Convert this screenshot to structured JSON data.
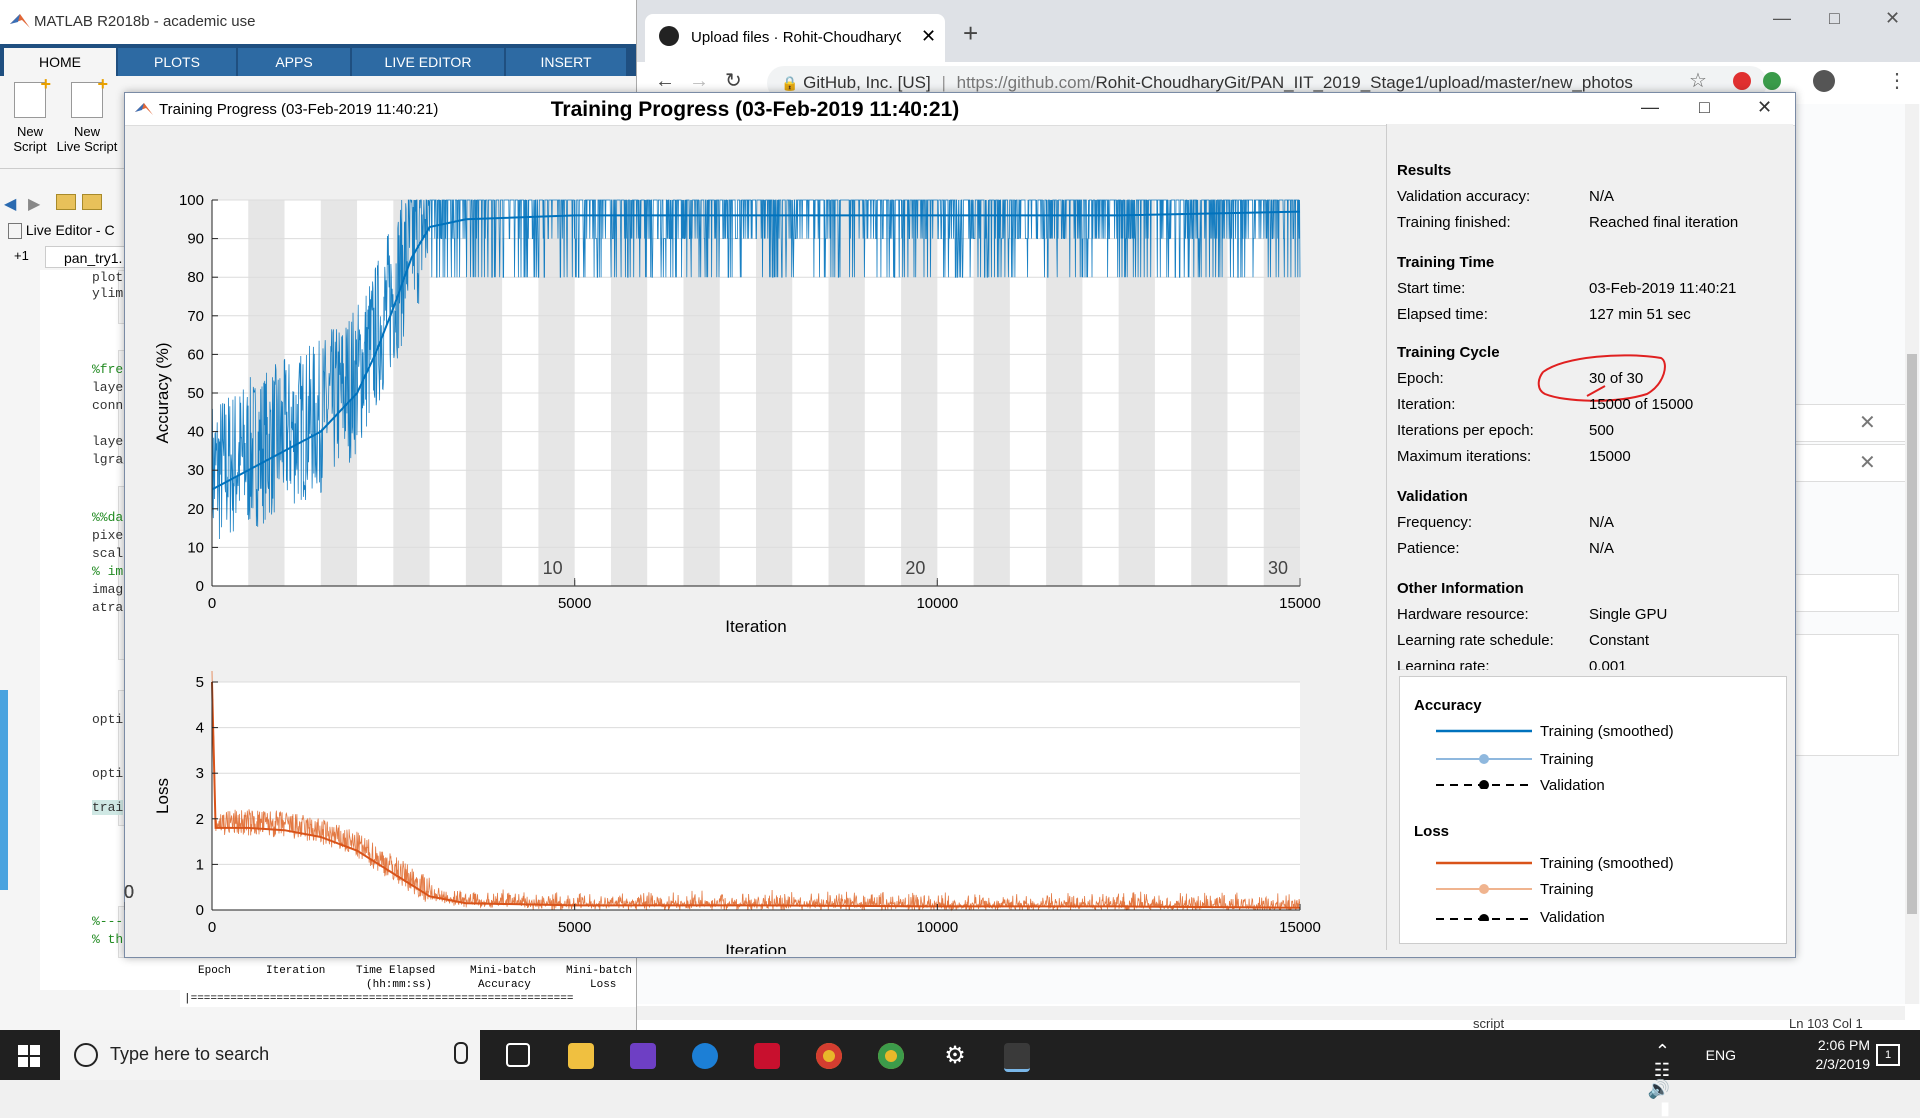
{
  "matlab": {
    "title": "MATLAB R2018b - academic use",
    "tabs": [
      "HOME",
      "PLOTS",
      "APPS",
      "LIVE EDITOR",
      "INSERT"
    ],
    "ribbon": [
      {
        "line1": "New",
        "line2": "Script"
      },
      {
        "line1": "New",
        "line2": "Live Script"
      }
    ],
    "editor_tab": "Live Editor - C",
    "file_tab": "pan_try1.",
    "file_tab_prefix": "+1",
    "code_lines": [
      "plot",
      "ylim",
      "%fre",
      "laye",
      "conn",
      "laye",
      "lgra",
      "%%da",
      "pixe",
      "scal",
      "% im",
      "imag",
      "atra",
      "opti",
      "opti",
      "trai",
      "%---",
      "% th"
    ],
    "cmd_headers": [
      "Epoch",
      "Iteration",
      "Time Elapsed",
      "(hh:mm:ss)",
      "Mini-batch",
      "Accuracy",
      "Mini-batch",
      "Loss"
    ],
    "cmd_rule": "|=========================================================="
  },
  "chrome": {
    "tab_title": "Upload files · Rohit-ChoudharyGi",
    "site_label": "GitHub, Inc. [US]",
    "url_prefix": "https://github.com/",
    "url_path": "Rohit-ChoudharyGit/PAN_IIT_2019_Stage1/upload/master/new_photos",
    "status_script": "script",
    "status_pos": "Ln 103 Col 1"
  },
  "dialog": {
    "window_title": "Training Progress (03-Feb-2019 11:40:21)",
    "plot_title": "Training Progress (03-Feb-2019 11:40:21)"
  },
  "chart_data": [
    {
      "type": "line",
      "name": "accuracy-plot",
      "ylabel": "Accuracy (%)",
      "xlabel": "Iteration",
      "xlim": [
        0,
        15000
      ],
      "ylim": [
        0,
        100
      ],
      "xticks": [
        0,
        5000,
        10000,
        15000
      ],
      "yticks": [
        0,
        10,
        20,
        30,
        40,
        50,
        60,
        70,
        80,
        90,
        100
      ],
      "epoch_labels": [
        10,
        20,
        30
      ],
      "epochs": 30,
      "iterations_per_epoch": 500,
      "series": [
        {
          "name": "Training (smoothed)",
          "color": "#0072bd",
          "x": [
            0,
            500,
            1000,
            1500,
            2000,
            2250,
            2500,
            2750,
            3000,
            3500,
            5000,
            7500,
            10000,
            12500,
            15000
          ],
          "y": [
            25,
            30,
            35,
            40,
            50,
            60,
            72,
            85,
            93,
            95,
            96,
            96,
            96,
            96,
            97
          ]
        }
      ]
    },
    {
      "type": "line",
      "name": "loss-plot",
      "ylabel": "Loss",
      "xlabel": "Iteration",
      "xlim": [
        0,
        15000
      ],
      "ylim": [
        0,
        5
      ],
      "xticks": [
        0,
        5000,
        10000,
        15000
      ],
      "yticks": [
        0,
        1,
        2,
        3,
        4,
        5
      ],
      "epoch_labels": [
        10,
        20,
        30
      ],
      "series": [
        {
          "name": "Training (smoothed)",
          "color": "#d95319",
          "x": [
            0,
            50,
            500,
            1000,
            1500,
            2000,
            2500,
            3000,
            3500,
            5000,
            7500,
            10000,
            12500,
            15000
          ],
          "y": [
            5,
            1.8,
            1.8,
            1.75,
            1.6,
            1.3,
            0.8,
            0.3,
            0.15,
            0.1,
            0.1,
            0.08,
            0.08,
            0.05
          ]
        }
      ]
    }
  ],
  "results": {
    "title": "Results",
    "rows": [
      {
        "k": "Validation accuracy:",
        "v": "N/A"
      },
      {
        "k": "Training finished:",
        "v": "Reached final iteration"
      }
    ]
  },
  "training_time": {
    "title": "Training Time",
    "rows": [
      {
        "k": "Start time:",
        "v": "03-Feb-2019 11:40:21"
      },
      {
        "k": "Elapsed time:",
        "v": "127 min 51 sec"
      }
    ]
  },
  "training_cycle": {
    "title": "Training Cycle",
    "rows": [
      {
        "k": "Epoch:",
        "v": "30 of 30"
      },
      {
        "k": "Iteration:",
        "v": "15000 of 15000"
      },
      {
        "k": "Iterations per epoch:",
        "v": "500"
      },
      {
        "k": "Maximum iterations:",
        "v": "15000"
      }
    ]
  },
  "validation": {
    "title": "Validation",
    "rows": [
      {
        "k": "Frequency:",
        "v": "N/A"
      },
      {
        "k": "Patience:",
        "v": "N/A"
      }
    ]
  },
  "other_info": {
    "title": "Other Information",
    "rows": [
      {
        "k": "Hardware resource:",
        "v": "Single GPU"
      },
      {
        "k": "Learning rate schedule:",
        "v": "Constant"
      },
      {
        "k": "Learning rate:",
        "v": "0.001"
      }
    ]
  },
  "legend": {
    "accuracy_title": "Accuracy",
    "loss_title": "Loss",
    "items": [
      "Training (smoothed)",
      "Training",
      "Validation"
    ],
    "accuracy_colors": [
      "#0072bd",
      "#8fb8de",
      "#000000"
    ],
    "loss_colors": [
      "#d95319",
      "#f0b48f",
      "#000000"
    ]
  },
  "taskbar": {
    "search_placeholder": "Type here to search",
    "language": "ENG",
    "time": "2:06 PM",
    "date": "2/3/2019",
    "notifications": "1"
  }
}
